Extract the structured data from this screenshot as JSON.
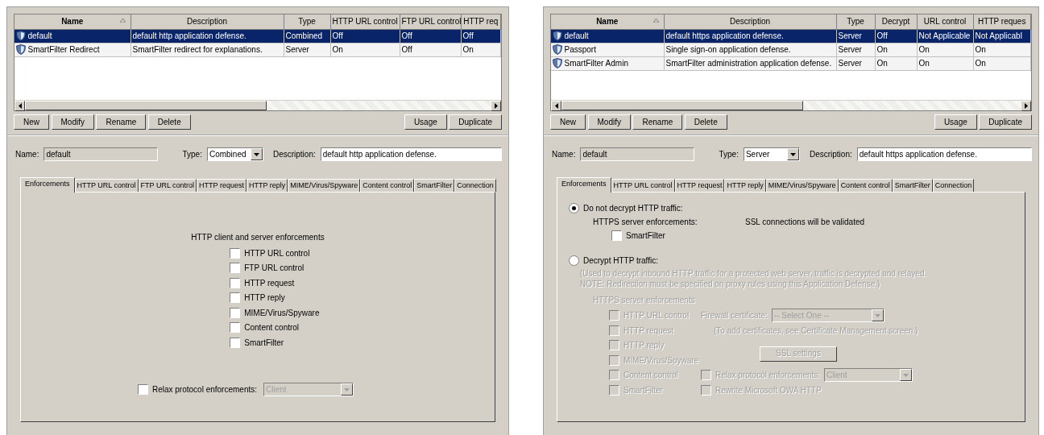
{
  "panels": [
    {
      "table": {
        "columns": [
          {
            "label": "Name",
            "sorted": true
          },
          {
            "label": "Description",
            "sorted": false
          },
          {
            "label": "Type",
            "sorted": false
          },
          {
            "label": "HTTP URL control",
            "sorted": false
          },
          {
            "label": "FTP URL control",
            "sorted": false
          },
          {
            "label": "HTTP req",
            "sorted": false
          }
        ],
        "rows": [
          {
            "cells": [
              "default",
              "default http application defense.",
              "Combined",
              "Off",
              "Off",
              "Off"
            ],
            "selected": true
          },
          {
            "cells": [
              "SmartFilter Redirect",
              "SmartFilter redirect for explanations.",
              "Server",
              "On",
              "Off",
              "On"
            ],
            "selected": false
          }
        ]
      },
      "left_buttons": [
        "New",
        "Modify",
        "Rename",
        "Delete"
      ],
      "right_buttons": [
        "Usage",
        "Duplicate"
      ],
      "form": {
        "name_label": "Name:",
        "name_value": "default",
        "name_readonly": true,
        "type_label": "Type:",
        "type_value": "Combined",
        "description_label": "Description:",
        "description_value": "default http application defense."
      },
      "tabs": [
        {
          "label": "Enforcements",
          "selected": true
        },
        {
          "label": "HTTP URL control",
          "selected": false
        },
        {
          "label": "FTP URL control",
          "selected": false
        },
        {
          "label": "HTTP request",
          "selected": false
        },
        {
          "label": "HTTP reply",
          "selected": false
        },
        {
          "label": "MIME/Virus/Spyware",
          "selected": false
        },
        {
          "label": "Content control",
          "selected": false
        },
        {
          "label": "SmartFilter",
          "selected": false
        },
        {
          "label": "Connection",
          "selected": false
        }
      ],
      "content": {
        "kind": "checklist",
        "heading": "HTTP client and server enforcements",
        "checkboxes": [
          {
            "label": "HTTP URL control",
            "checked": false
          },
          {
            "label": "FTP URL control",
            "checked": false
          },
          {
            "label": "HTTP request",
            "checked": false
          },
          {
            "label": "HTTP reply",
            "checked": false
          },
          {
            "label": "MIME/Virus/Spyware",
            "checked": false
          },
          {
            "label": "Content control",
            "checked": false
          },
          {
            "label": "SmartFilter",
            "checked": false
          }
        ],
        "relax": {
          "label": "Relax protocol enforcements:",
          "checked": false,
          "value": "Client"
        }
      }
    },
    {
      "table": {
        "columns": [
          {
            "label": "Name",
            "sorted": true
          },
          {
            "label": "Description",
            "sorted": false
          },
          {
            "label": "Type",
            "sorted": false
          },
          {
            "label": "Decrypt",
            "sorted": false
          },
          {
            "label": "URL control",
            "sorted": false
          },
          {
            "label": "HTTP reques",
            "sorted": false
          }
        ],
        "rows": [
          {
            "cells": [
              "default",
              "default https application defense.",
              "Server",
              "Off",
              "Not Applicable",
              "Not Applicabl"
            ],
            "selected": true
          },
          {
            "cells": [
              "Passport",
              "Single sign-on application defense.",
              "Server",
              "On",
              "On",
              "On"
            ],
            "selected": false
          },
          {
            "cells": [
              "SmartFilter Admin",
              "SmartFilter administration application defense.",
              "Server",
              "On",
              "On",
              "On"
            ],
            "selected": false
          }
        ]
      },
      "left_buttons": [
        "New",
        "Modify",
        "Rename",
        "Delete"
      ],
      "right_buttons": [
        "Usage",
        "Duplicate"
      ],
      "form": {
        "name_label": "Name:",
        "name_value": "default",
        "name_readonly": true,
        "type_label": "Type:",
        "type_value": "Server",
        "description_label": "Description:",
        "description_value": "default https application defense."
      },
      "tabs": [
        {
          "label": "Enforcements",
          "selected": true
        },
        {
          "label": "HTTP URL control",
          "selected": false
        },
        {
          "label": "HTTP request",
          "selected": false
        },
        {
          "label": "HTTP reply",
          "selected": false
        },
        {
          "label": "MIME/Virus/Spyware",
          "selected": false
        },
        {
          "label": "Content control",
          "selected": false
        },
        {
          "label": "SmartFilter",
          "selected": false
        },
        {
          "label": "Connection",
          "selected": false
        }
      ],
      "content": {
        "kind": "decrypt_options",
        "no_decrypt": {
          "label": "Do not decrypt HTTP traffic:",
          "selected": true,
          "enforcements_label": "HTTPS server enforcements:",
          "validation_note": "SSL connections will be validated",
          "checkboxes": [
            {
              "label": "SmartFilter",
              "checked": false
            }
          ]
        },
        "decrypt": {
          "label": "Decrypt HTTP traffic:",
          "selected": false,
          "note_lines": [
            "(Used to decrypt inbound HTTP traffic for a protected web server, traffic is decrypted and relayed.",
            "NOTE: Redirection must be specified on proxy rules using this Application Defense.)"
          ],
          "enforcements_label": "HTTPS server enforcements",
          "checkboxes": [
            {
              "label": "HTTP URL control",
              "checked": false
            },
            {
              "label": "HTTP request",
              "checked": false
            },
            {
              "label": "HTTP reply",
              "checked": false
            },
            {
              "label": "MIME/Virus/Spyware",
              "checked": false
            },
            {
              "label": "Content control",
              "checked": false
            },
            {
              "label": "SmartFilter",
              "checked": false
            }
          ],
          "certificate_label": "Firewall certificate:",
          "certificate_value": "-- Select One --",
          "certificate_hint": "(To add certificates, see Certificate Management screen.)",
          "ssl_button": "SSL settings",
          "relax": {
            "label": "Relax protocol enforcements:",
            "checked": false,
            "value": "Client"
          },
          "rewrite": {
            "label": "Rewrite Microsoft OWA HTTP",
            "checked": false
          }
        }
      }
    }
  ]
}
